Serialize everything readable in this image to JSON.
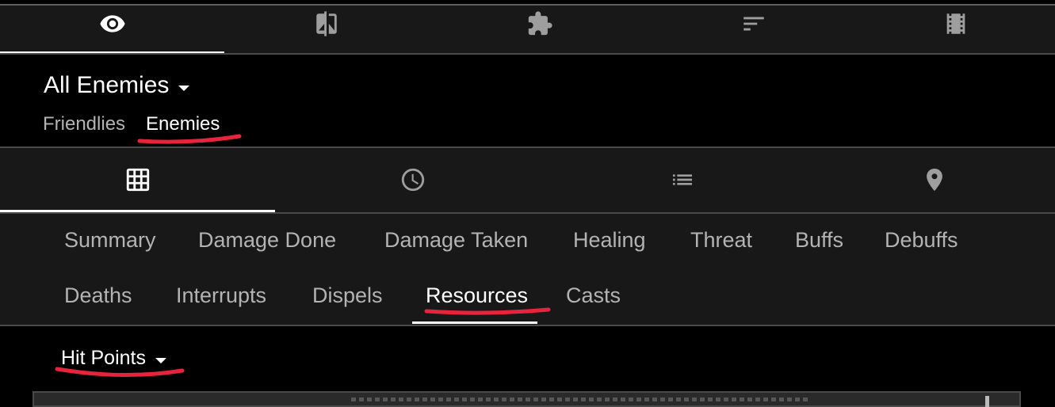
{
  "view_tabs": [
    {
      "icon": "eye-icon"
    },
    {
      "icon": "compare-icon"
    },
    {
      "icon": "puzzle-icon"
    },
    {
      "icon": "sort-icon"
    },
    {
      "icon": "film-icon"
    }
  ],
  "filter": {
    "selected_label": "All Enemies",
    "factions": [
      "Friendlies",
      "Enemies"
    ],
    "active_faction": "Enemies"
  },
  "category_tabs": [
    {
      "icon": "grid-icon"
    },
    {
      "icon": "clock-icon"
    },
    {
      "icon": "list-icon"
    },
    {
      "icon": "location-pin-icon"
    }
  ],
  "metrics": {
    "row1": [
      "Summary",
      "Damage Done",
      "Damage Taken",
      "Healing",
      "Threat",
      "Buffs",
      "Debuffs"
    ],
    "row2": [
      "Deaths",
      "Interrupts",
      "Dispels",
      "Resources",
      "Casts"
    ],
    "active": "Resources"
  },
  "resource_selector": {
    "label": "Hit Points"
  },
  "colors": {
    "background": "#000000",
    "tab_bar": "#181818",
    "divider": "#4a4a4a",
    "inactive_text": "#b3b3b3",
    "active_text": "#ffffff",
    "annotation": "#e8243c"
  }
}
